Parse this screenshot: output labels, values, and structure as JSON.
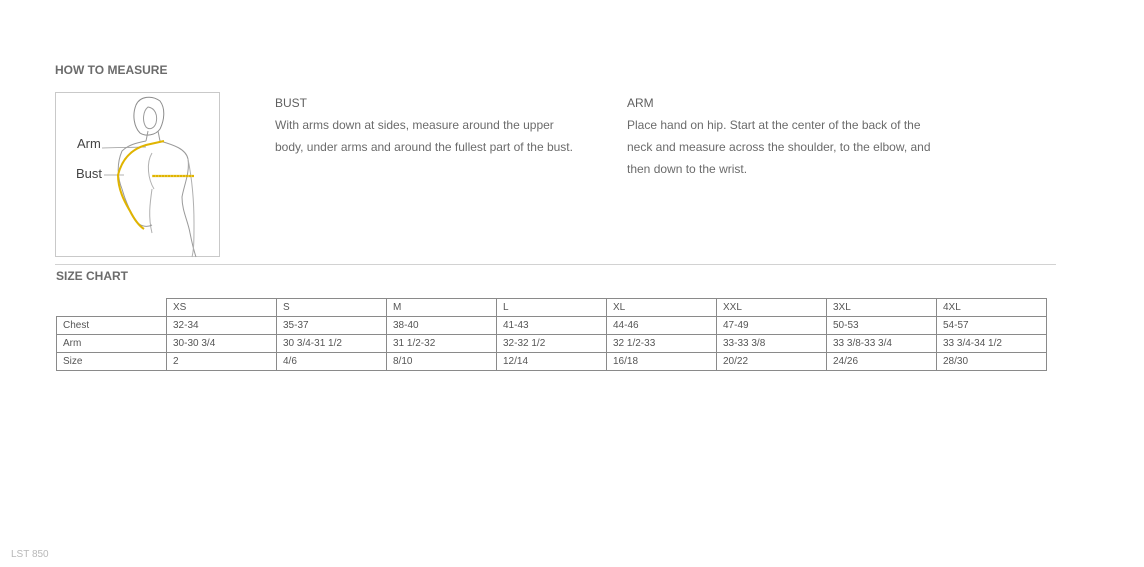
{
  "how_to_measure": {
    "heading": "HOW TO MEASURE",
    "illustration": {
      "arm_label": "Arm",
      "bust_label": "Bust"
    },
    "bust": {
      "title": "BUST",
      "lines": [
        "With arms down at sides, measure around the upper",
        "body, under arms and around the fullest part of the bust."
      ]
    },
    "arm": {
      "title": "ARM",
      "lines": [
        "Place hand on hip. Start at the center of the back of the",
        "neck and measure across the shoulder, to the elbow, and",
        "then down to the wrist."
      ]
    }
  },
  "size_chart": {
    "heading": "SIZE CHART",
    "columns": [
      "XS",
      "S",
      "M",
      "L",
      "XL",
      "XXL",
      "3XL",
      "4XL"
    ],
    "rows": [
      {
        "label": "Chest",
        "values": [
          "32-34",
          "35-37",
          "38-40",
          "41-43",
          "44-46",
          "47-49",
          "50-53",
          "54-57"
        ]
      },
      {
        "label": "Arm",
        "values": [
          "30-30 3/4",
          "30 3/4-31 1/2",
          "31 1/2-32",
          "32-32 1/2",
          "32 1/2-33",
          "33-33 3/8",
          "33 3/8-33 3/4",
          "33 3/4-34 1/2"
        ]
      },
      {
        "label": "Size",
        "values": [
          "2",
          "4/6",
          "8/10",
          "12/14",
          "16/18",
          "20/22",
          "24/26",
          "28/30"
        ]
      }
    ]
  },
  "footer": {
    "code": "LST 850"
  },
  "colors": {
    "measure_line": "#e0b400",
    "text": "#666666",
    "border": "#8a8a8a"
  }
}
